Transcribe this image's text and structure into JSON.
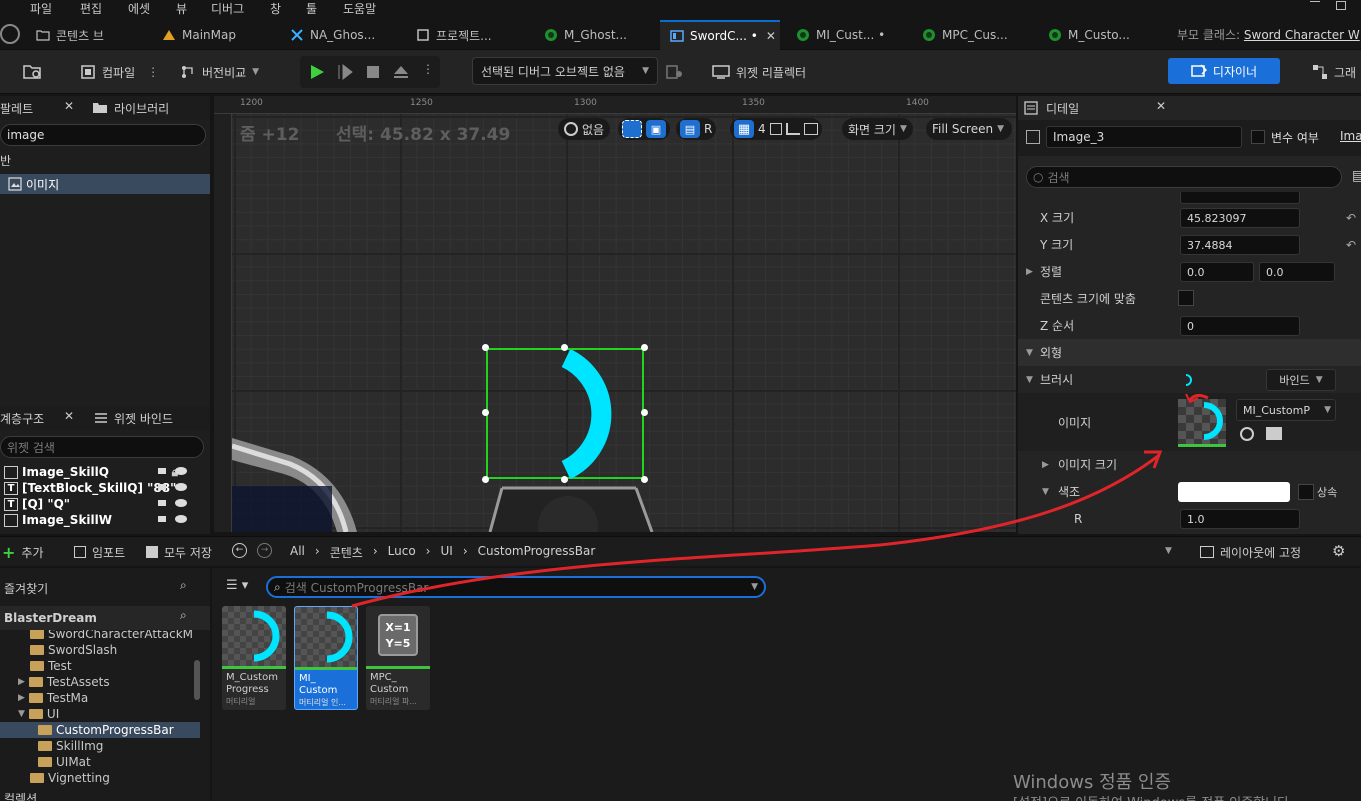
{
  "menu": [
    "파일",
    "편집",
    "에셋",
    "뷰",
    "디버그",
    "창",
    "툴",
    "도움말"
  ],
  "tabs": [
    {
      "label": "콘텐츠 브",
      "icon": "folder-icon"
    },
    {
      "label": "MainMap",
      "icon": "level-icon"
    },
    {
      "label": "NA_Ghos...",
      "icon": "niagara-icon"
    },
    {
      "label": "프로젝트...",
      "icon": "settings-icon"
    },
    {
      "label": "M_Ghost...",
      "icon": "material-icon"
    },
    {
      "label": "SwordC... •",
      "icon": "widget-icon"
    },
    {
      "label": "MI_Cust... •",
      "icon": "material-instance-icon"
    },
    {
      "label": "MPC_Cus...",
      "icon": "material-icon"
    },
    {
      "label": "M_Custo...",
      "icon": "material-icon"
    }
  ],
  "parent_class_label": "부모 클래스:",
  "parent_class_value": "Sword Character W",
  "toolbar": {
    "compile": "컴파일",
    "diff": "버전비교",
    "debug_object": "선택된 디버그 오브젝트 없음",
    "widget_reflector": "위젯 리플렉터",
    "designer": "디자이너",
    "graph": "그래"
  },
  "palette": {
    "tab_palette": "팔레트",
    "tab_library": "라이브러리",
    "search_value": "image",
    "category": "반",
    "item": "이미지"
  },
  "hierarchy": {
    "tab_hierarchy": "계층구조",
    "tab_bindings": "위젯 바인드",
    "search_placeholder": "위젯 검색",
    "items": [
      "Image_SkillQ",
      "[TextBlock_SkillQ] \"88\"",
      "[Q] \"Q\"",
      "Image_SkillW"
    ]
  },
  "viewport": {
    "ruler_top": [
      "1250",
      "1300",
      "1350",
      "1400",
      "1200"
    ],
    "zoom": "줌 +12",
    "selection": "선택: 45.82 x 37.49",
    "none_label": "없음",
    "r_label": "R",
    "grid_num": "4",
    "screen_size": "화면 크기",
    "fill_screen": "Fill Screen"
  },
  "details": {
    "tab": "디테일",
    "name": "Image_3",
    "is_variable": "변수 여부",
    "ima": "Ima",
    "search_placeholder": "검색",
    "size_x_label": "X 크기",
    "size_x": "45.823097",
    "size_y_label": "Y 크기",
    "size_y": "37.4884",
    "align_label": "정렬",
    "align_x": "0.0",
    "align_y": "0.0",
    "size_to_content": "콘텐츠 크기에 맞춤",
    "z_order_label": "Z 순서",
    "z_order": "0",
    "appearance": "외형",
    "brush": "브러시",
    "bind": "바인드",
    "image_label": "이미지",
    "image_asset": "MI_CustomP",
    "image_size": "이미지 크기",
    "tint": "색조",
    "inherit": "상속",
    "r_label": "R",
    "r_value": "1.0"
  },
  "content_browser": {
    "add": "추가",
    "import": "임포트",
    "save_all": "모두 저장",
    "path": [
      "All",
      "콘텐츠",
      "Luco",
      "UI",
      "CustomProgressBar"
    ],
    "lock_layout": "레이아웃에 고정",
    "favorites": "즐겨찾기",
    "project": "BlasterDream",
    "search_placeholder": "검색 CustomProgressBar",
    "tree": [
      {
        "label": "SwordCharacterAttackM",
        "indent": 1
      },
      {
        "label": "SwordSlash",
        "indent": 1
      },
      {
        "label": "Test",
        "indent": 1
      },
      {
        "label": "TestAssets",
        "indent": 1
      },
      {
        "label": "TestMa",
        "indent": 1
      },
      {
        "label": "UI",
        "indent": 1
      },
      {
        "label": "CustomProgressBar",
        "indent": 2
      },
      {
        "label": "SkillImg",
        "indent": 2
      },
      {
        "label": "UIMat",
        "indent": 2
      },
      {
        "label": "Vignetting",
        "indent": 1
      }
    ],
    "collections": "컬렉션",
    "assets": [
      {
        "name": "M_Custom Progress",
        "type": "머티리얼"
      },
      {
        "name": "MI_ Custom",
        "type": "머티리얼 인..."
      },
      {
        "name": "MPC_ Custom",
        "type": "머티리얼 파..."
      }
    ],
    "mpc_text_1": "X=1",
    "mpc_text_2": "Y=5"
  },
  "watermark": {
    "line1": "Windows 정품 인증",
    "line2": "[설정]으로 이동하여 Windows를 정품 인증합니다."
  },
  "colors": {
    "accent": "#1a70d8",
    "cyan": "#00e5ff",
    "select_green": "#22d322",
    "arrow_red": "#e0252a"
  }
}
